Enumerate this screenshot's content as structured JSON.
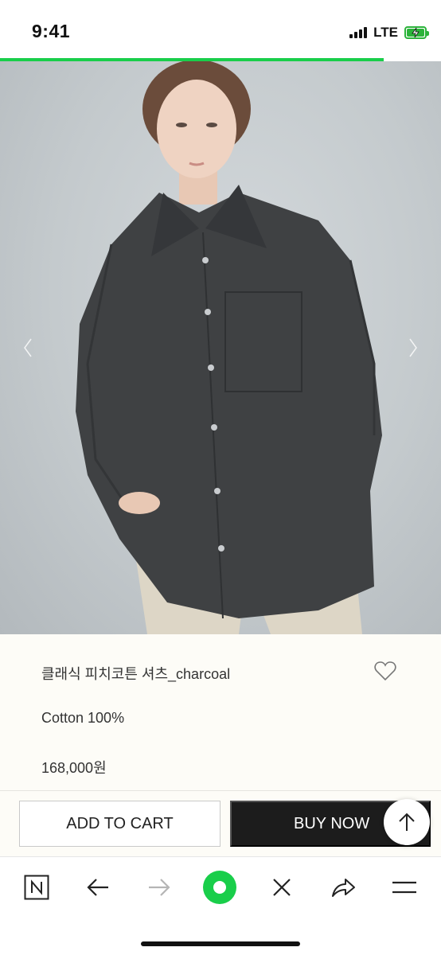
{
  "status_bar": {
    "time": "9:41",
    "network": "LTE",
    "signal_bars": 4,
    "battery_icon": "battery-charging-icon",
    "battery_color": "#2bb33a"
  },
  "page_load_progress": 0.87,
  "progress_color": "#19ce4a",
  "product": {
    "image_alt_icon": "product-photo",
    "name": "클래식 피치코튼 셔츠_charcoal",
    "material": "Cotton 100%",
    "price": "168,000원",
    "wishlist_icon": "heart-icon"
  },
  "carousel": {
    "prev_icon": "chevron-left-icon",
    "next_icon": "chevron-right-icon"
  },
  "actions": {
    "add_to_cart_label": "ADD TO CART",
    "buy_now_label": "BUY NOW",
    "scroll_top_icon": "arrow-up-icon"
  },
  "browser_toolbar": {
    "items": [
      {
        "icon": "naver-n-icon"
      },
      {
        "icon": "back-arrow-icon"
      },
      {
        "icon": "forward-arrow-icon"
      },
      {
        "icon": "green-dot-home-icon"
      },
      {
        "icon": "close-icon"
      },
      {
        "icon": "share-icon"
      },
      {
        "icon": "menu-icon"
      }
    ],
    "accent_color": "#19ce4a"
  }
}
